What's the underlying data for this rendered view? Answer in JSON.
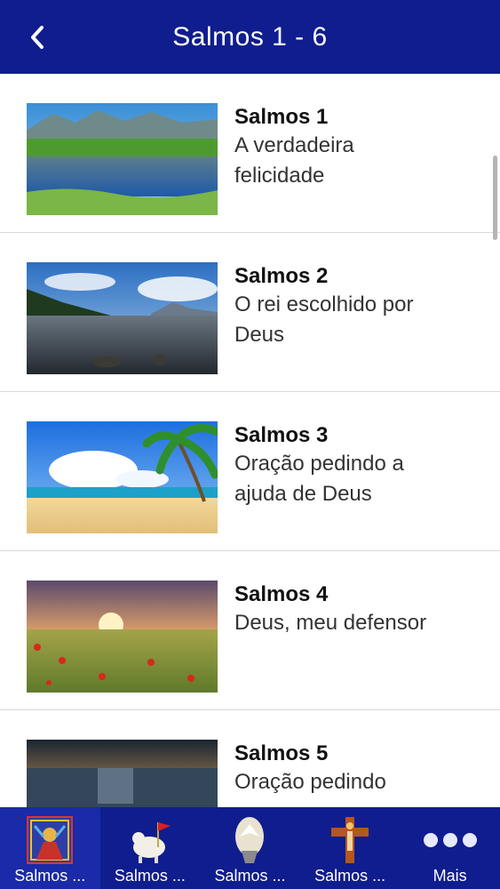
{
  "header": {
    "title": "Salmos 1 - 6",
    "back_icon": "chevron-left-icon"
  },
  "items": [
    {
      "title": "Salmos 1",
      "subtitle_lines": [
        "A verdadeira",
        "felicidade"
      ],
      "image": "lake-mountain-landscape"
    },
    {
      "title": "Salmos 2",
      "subtitle_lines": [
        "O rei escolhido por",
        "Deus"
      ],
      "image": "mountain-lake-clouds"
    },
    {
      "title": "Salmos 3",
      "subtitle_lines": [
        "Oração pedindo a",
        "ajuda de Deus"
      ],
      "image": "tropical-beach-palm"
    },
    {
      "title": "Salmos 4",
      "subtitle_lines": [
        "Deus, meu defensor"
      ],
      "image": "sunset-poppy-field"
    },
    {
      "title": "Salmos 5",
      "subtitle_lines": [
        "Oração pedindo"
      ],
      "image": "sunset-over-sea"
    }
  ],
  "tabs": [
    {
      "label": "Salmos ...",
      "icon": "stained-glass-icon",
      "active": true
    },
    {
      "label": "Salmos ...",
      "icon": "lamb-banner-icon",
      "active": false
    },
    {
      "label": "Salmos ...",
      "icon": "dove-holy-spirit-icon",
      "active": false
    },
    {
      "label": "Salmos ...",
      "icon": "crucifix-icon",
      "active": false
    },
    {
      "label": "Mais",
      "icon": "more-dots-icon",
      "active": false
    }
  ],
  "colors": {
    "bar": "#101d8e",
    "active_tab": "#1a2aa8"
  }
}
